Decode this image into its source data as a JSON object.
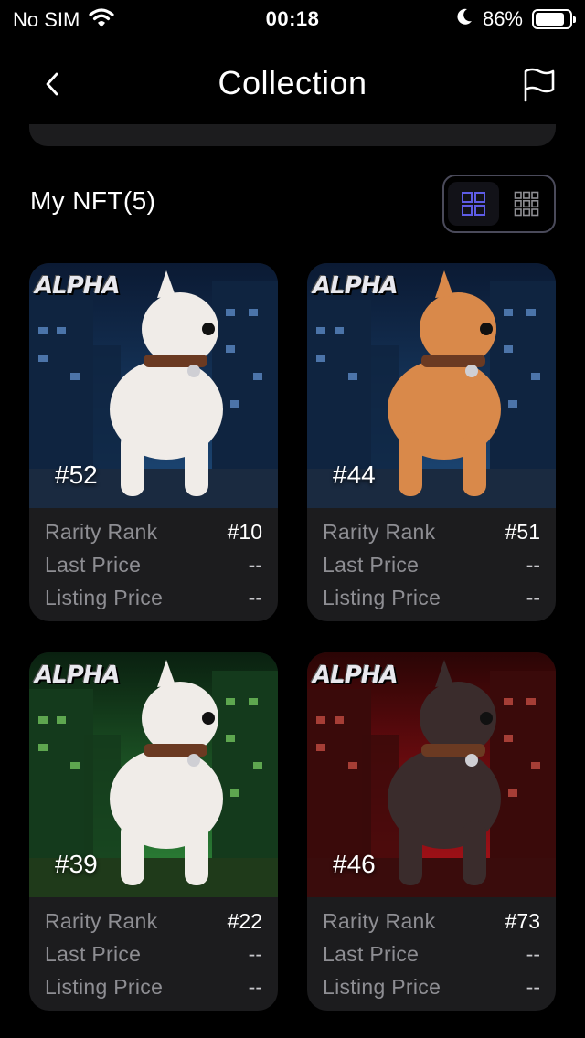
{
  "status_bar": {
    "carrier": "No SIM",
    "time": "00:18",
    "battery": "86%",
    "battery_level": 0.86
  },
  "header": {
    "title": "Collection",
    "back_icon": "chevron-left-icon",
    "flag_icon": "flag-icon"
  },
  "section": {
    "title": "My NFT(5)"
  },
  "view_toggle": {
    "large_grid_icon": "grid-2x2-icon",
    "small_grid_icon": "grid-3x3-icon",
    "active_color": "#5e5ce6",
    "inactive_color": "#8e8e93"
  },
  "logo_text": "ALPHA",
  "labels": {
    "rarity": "Rarity Rank",
    "last": "Last Price",
    "listing": "Listing Price"
  },
  "cards": [
    {
      "token": "#52",
      "rarity": "#10",
      "last_price": "--",
      "listing_price": "--",
      "theme": "blue",
      "dog_color": "#f0ece8"
    },
    {
      "token": "#44",
      "rarity": "#51",
      "last_price": "--",
      "listing_price": "--",
      "theme": "blue",
      "dog_color": "#d9894a"
    },
    {
      "token": "#39",
      "rarity": "#22",
      "last_price": "--",
      "listing_price": "--",
      "theme": "green",
      "dog_color": "#f0ece8"
    },
    {
      "token": "#46",
      "rarity": "#73",
      "last_price": "--",
      "listing_price": "--",
      "theme": "red",
      "dog_color": "#3a2c2c"
    }
  ]
}
